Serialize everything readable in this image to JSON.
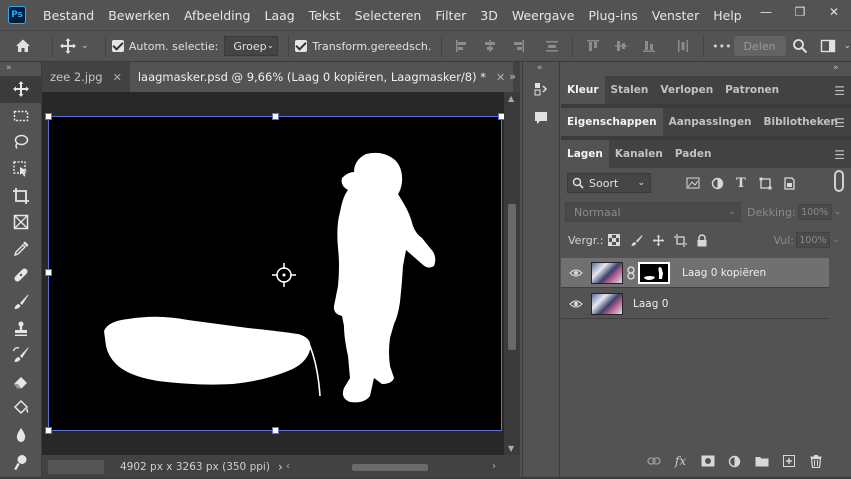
{
  "app": {
    "logo": "Ps"
  },
  "menu": [
    "Bestand",
    "Bewerken",
    "Afbeelding",
    "Laag",
    "Tekst",
    "Selecteren",
    "Filter",
    "3D",
    "Weergave",
    "Plug-ins",
    "Venster",
    "Help"
  ],
  "window_controls": {
    "minimize": "—",
    "maximize": "❐",
    "close": "✕"
  },
  "options": {
    "auto_select_label": "Autom. selectie:",
    "auto_select_checked": true,
    "auto_select_target": "Groep",
    "transform_label": "Transform.gereedsch.",
    "transform_checked": true,
    "more": "•••",
    "share_label": "Delen"
  },
  "tool_panel": {
    "collapse": "»",
    "tools": [
      "move-tool",
      "marquee-tool",
      "lasso-tool",
      "object-select-tool",
      "crop-tool",
      "frame-tool",
      "eyedropper-tool",
      "healing-tool",
      "brush-tool",
      "stamp-tool",
      "history-brush-tool",
      "eraser-tool",
      "bucket-tool",
      "blur-tool",
      "dodge-tool"
    ]
  },
  "tabs": [
    {
      "label": "zee 2.jpg",
      "active": false
    },
    {
      "label": "laagmasker.psd @ 9,66% (Laag 0 kopiëren, Laagmasker/8) *",
      "active": true
    }
  ],
  "tabs_more": "»",
  "status": {
    "doc_info": "4902 px x 3263 px (350 ppi)",
    "arrow": "›"
  },
  "dock": {
    "collapse": "«"
  },
  "panels": {
    "top_tabs": [
      "Kleur",
      "Stalen",
      "Verlopen",
      "Patronen"
    ],
    "mid_tabs": [
      "Eigenschappen",
      "Aanpassingen",
      "Bibliotheken"
    ],
    "layer_tabs": [
      "Lagen",
      "Kanalen",
      "Paden"
    ],
    "panel_collapse": "»",
    "menu_glyph": "☰"
  },
  "layers": {
    "filter_label": "Soort",
    "blend_mode": "Normaal",
    "opacity_label": "Dekking:",
    "opacity_value": "100%",
    "lock_label": "Vergr.:",
    "fill_label": "Vul:",
    "fill_value": "100%",
    "items": [
      {
        "name": "Laag 0 kopiëren",
        "has_mask": true,
        "selected": true,
        "visible": true
      },
      {
        "name": "Laag 0",
        "has_mask": false,
        "selected": false,
        "visible": true
      }
    ],
    "footer_icons": [
      "link-icon",
      "fx-icon",
      "mask-icon",
      "adjustment-icon",
      "folder-icon",
      "new-layer-icon",
      "trash-icon"
    ]
  },
  "colors": {
    "accent_bbox": "#5b6fd6",
    "bg": "#535353",
    "canvas_bg": "#282828"
  }
}
